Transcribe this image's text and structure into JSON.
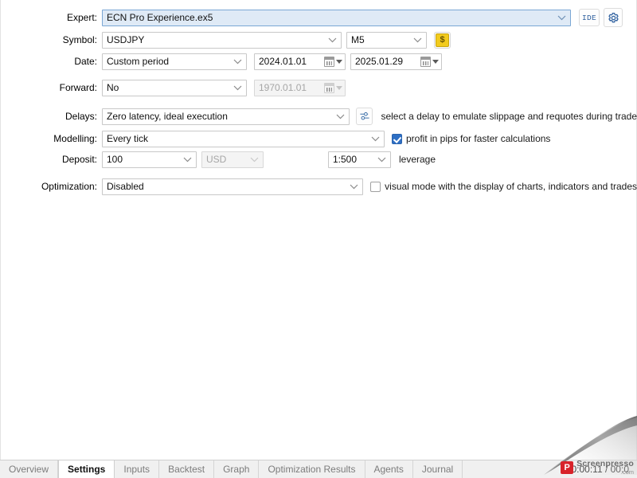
{
  "form": {
    "expert": {
      "label": "Expert:",
      "value": "ECN Pro Experience.ex5",
      "ide_button": "IDE",
      "settings_icon": "gear-icon"
    },
    "symbol": {
      "label": "Symbol:",
      "value": "USDJPY",
      "timeframe": "M5",
      "money_icon": "dollar-icon"
    },
    "date": {
      "label": "Date:",
      "mode": "Custom period",
      "from": "2024.01.01",
      "to": "2025.01.29"
    },
    "forward": {
      "label": "Forward:",
      "mode": "No",
      "date": "1970.01.01"
    },
    "delays": {
      "label": "Delays:",
      "value": "Zero latency, ideal execution",
      "hint": "select a delay to emulate slippage and requotes during trade",
      "button_icon": "sliders-icon"
    },
    "modelling": {
      "label": "Modelling:",
      "value": "Every tick",
      "checkbox_label": "profit in pips for faster calculations",
      "checkbox_checked": true
    },
    "deposit": {
      "label": "Deposit:",
      "amount": "100",
      "currency": "USD",
      "currency_disabled": true,
      "leverage": "1:500",
      "leverage_label": "leverage"
    },
    "optimization": {
      "label": "Optimization:",
      "value": "Disabled",
      "checkbox_label": "visual mode with the display of charts, indicators and trades",
      "checkbox_checked": false
    }
  },
  "tabs": [
    {
      "label": "Overview",
      "active": false
    },
    {
      "label": "Settings",
      "active": true
    },
    {
      "label": "Inputs",
      "active": false
    },
    {
      "label": "Backtest",
      "active": false
    },
    {
      "label": "Graph",
      "active": false
    },
    {
      "label": "Optimization Results",
      "active": false
    },
    {
      "label": "Agents",
      "active": false
    },
    {
      "label": "Journal",
      "active": false
    }
  ],
  "status": {
    "timer": "00:00:11 / 00:0"
  },
  "watermark": {
    "mark": "P",
    "name": "Screenpresso",
    "domain": ".com"
  },
  "colors": {
    "focus_fill": "#dfeaf6",
    "focus_border": "#7aa7d4",
    "checkbox_on": "#2e6fc4",
    "money_yellow": "#f2cb1d",
    "watermark_red": "#d8232a"
  }
}
